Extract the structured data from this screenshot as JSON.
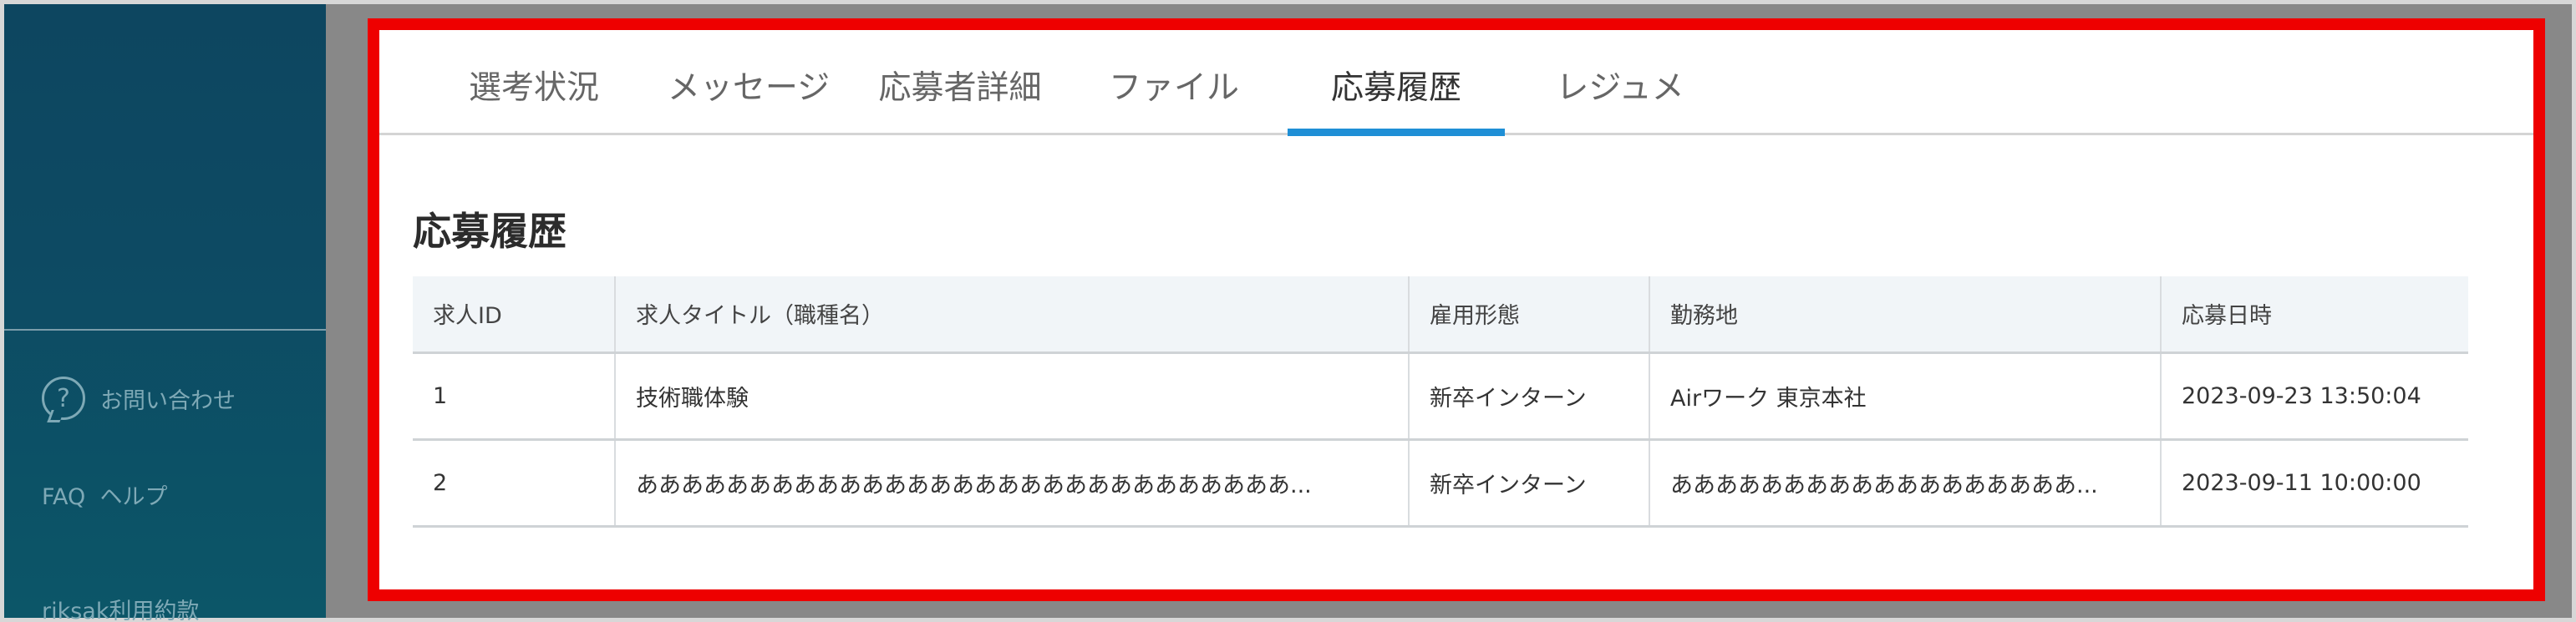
{
  "sidebar": {
    "contact_label": "お問い合わせ",
    "help_label": "FAQ  ヘルプ",
    "terms_label": "riksak利用約款"
  },
  "tabs": [
    {
      "label": "選考状況"
    },
    {
      "label": "メッセージ"
    },
    {
      "label": "応募者詳細"
    },
    {
      "label": "ファイル"
    },
    {
      "label": "応募履歴"
    },
    {
      "label": "レジュメ"
    }
  ],
  "active_tab": "応募履歴",
  "section": {
    "title": "応募履歴"
  },
  "table": {
    "headers": [
      "求人ID",
      "求人タイトル（職種名）",
      "雇用形態",
      "勤務地",
      "応募日時"
    ],
    "rows": [
      [
        "1",
        "技術職体験",
        "新卒インターン",
        "Airワーク 東京本社",
        "2023-09-23 13:50:04"
      ],
      [
        "2",
        "あああああああああああああああああああああああああああああ...",
        "新卒インターン",
        "ああああああああああああああああああ...",
        "2023-09-11 10:00:00"
      ]
    ]
  },
  "colors": {
    "sidebar": "#0d4a63",
    "highlight_border": "#ee0000",
    "tab_accent": "#1f8fd6"
  },
  "icons": {
    "contact": "question-bubble-icon"
  }
}
